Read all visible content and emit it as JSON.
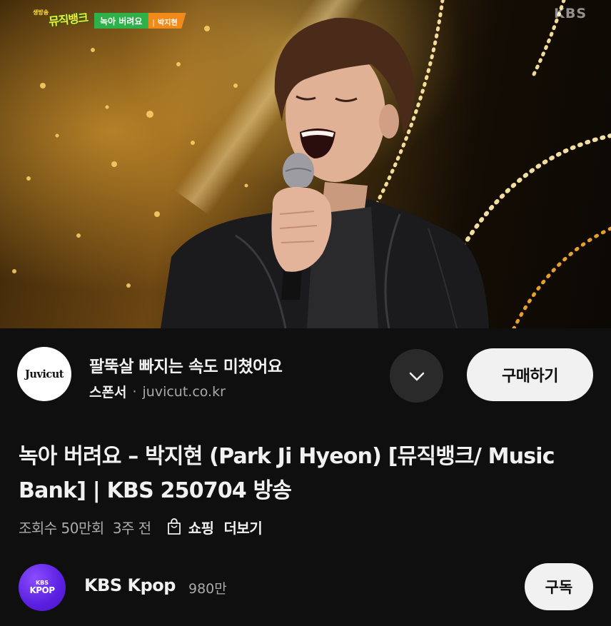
{
  "video": {
    "show_logo_small": "생방송",
    "show_logo_text": "뮤직뱅크",
    "song_tag": "녹아 버려요",
    "artist_tag": "박지현",
    "watermark": "KBS"
  },
  "ad": {
    "brand_logo_text": "Juvicut",
    "title": "팔뚝살 빠지는 속도 미쳤어요",
    "sponsor_label": "스폰서",
    "separator": "·",
    "domain": "juvicut.co.kr",
    "expand_icon": "chevron-down-icon",
    "cta_label": "구매하기"
  },
  "title": {
    "text": "녹아 버려요 – 박지현 (Park Ji Hyeon) [뮤직뱅크/ Music Bank] | KBS 250704 방송"
  },
  "meta": {
    "views": "조회수 50만회",
    "age": "3주 전",
    "shopping_icon": "shopping-bag-icon",
    "shopping_label": "쇼핑",
    "more_label": "더보기"
  },
  "channel": {
    "avatar_top": "KBS",
    "avatar_bottom": "KPOP",
    "name": "KBS Kpop",
    "subscribers": "980만",
    "subscribe_label": "구독"
  },
  "colors": {
    "background": "#0f0f0f",
    "text_primary": "#f1f1f1",
    "text_secondary": "#aaaaaa",
    "button_light": "#f1f1f1",
    "channel_avatar": "#5a1fe0"
  }
}
